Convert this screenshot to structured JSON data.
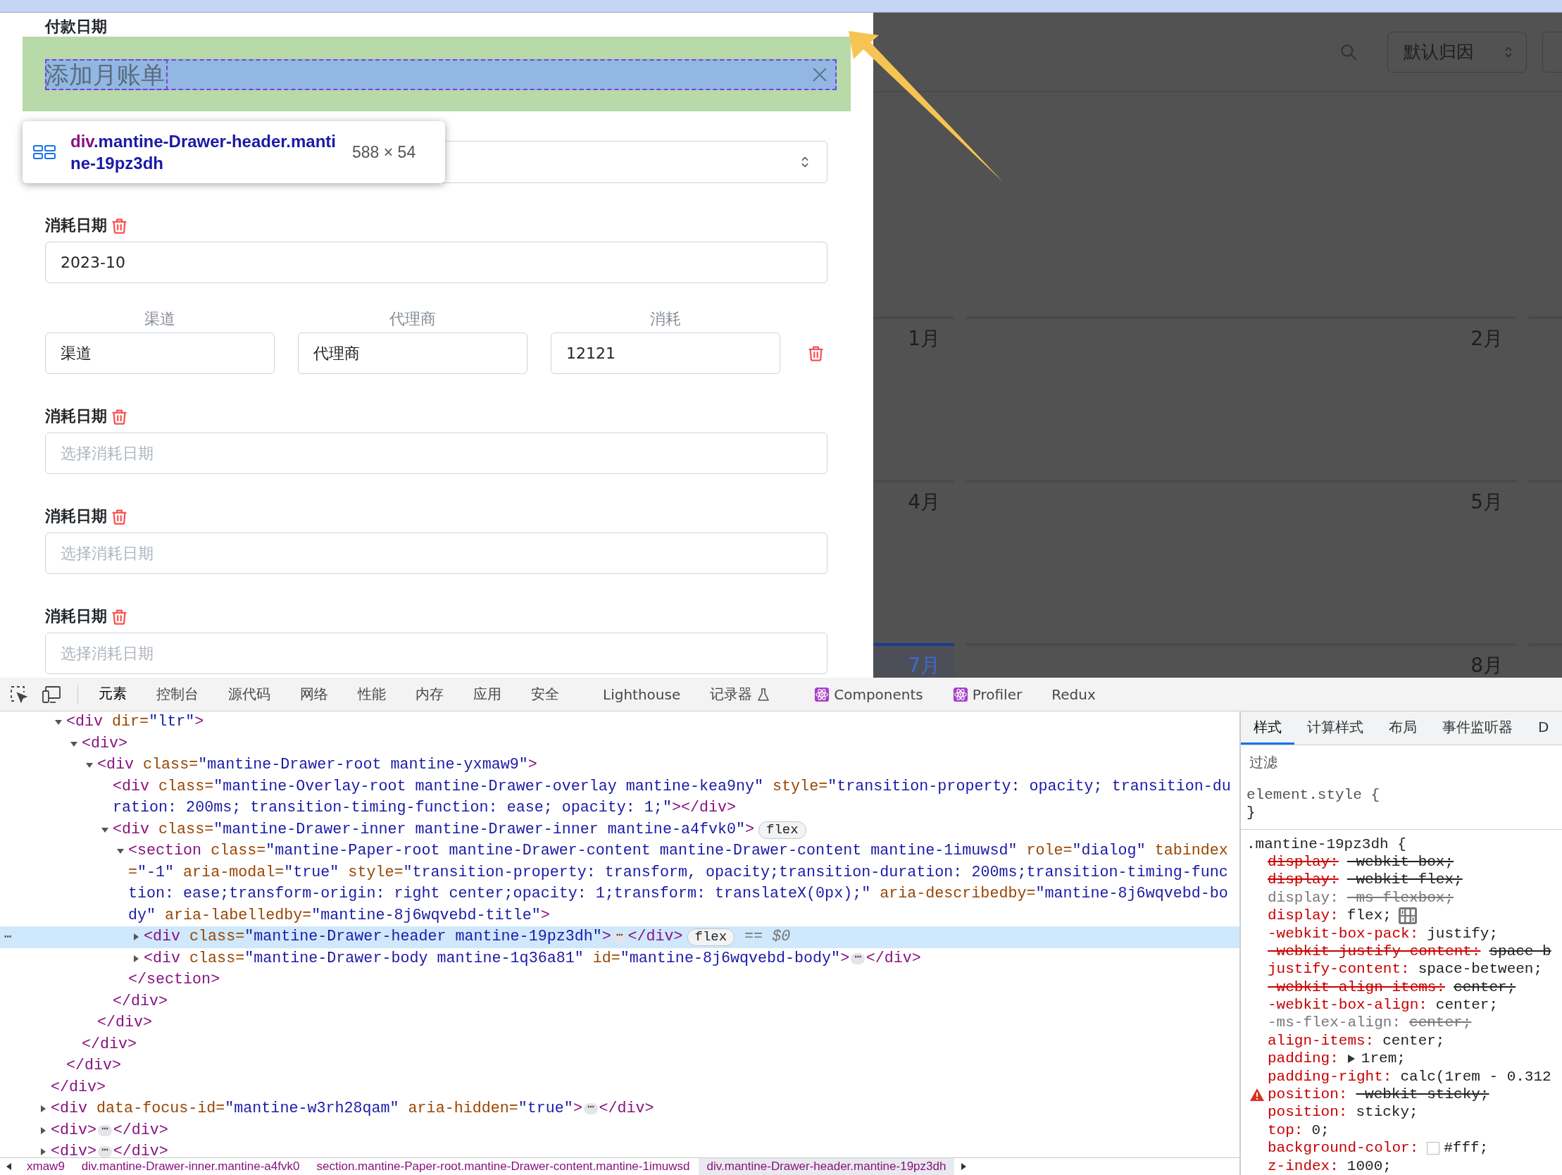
{
  "drawer": {
    "payment_date_label": "付款日期",
    "header": {
      "title": "添加月账单"
    },
    "inspector_tooltip": {
      "tag": "div",
      "classes": ".mantine-Drawer-header.mantine-19pz3dh",
      "size": "588 × 54"
    },
    "blocks": [
      {
        "kind": "date",
        "label": "消耗日期",
        "value": "2023-10"
      },
      {
        "kind": "row",
        "columns": [
          {
            "label": "渠道",
            "value": "渠道"
          },
          {
            "label": "代理商",
            "value": "代理商"
          },
          {
            "label": "消耗",
            "value": "12121"
          }
        ]
      },
      {
        "kind": "date",
        "label": "消耗日期",
        "placeholder": "选择消耗日期"
      },
      {
        "kind": "date",
        "label": "消耗日期",
        "placeholder": "选择消耗日期"
      },
      {
        "kind": "date",
        "label": "消耗日期",
        "placeholder": "选择消耗日期"
      }
    ]
  },
  "background_page": {
    "attribution_select": {
      "value": "默认归因"
    },
    "month_rows": [
      {
        "cells": [
          {
            "label": "1月",
            "selected": false
          },
          {
            "label": "2月",
            "selected": false
          }
        ]
      },
      {
        "cells": [
          {
            "label": "4月",
            "selected": false
          },
          {
            "label": "5月",
            "selected": false
          }
        ]
      },
      {
        "cells": [
          {
            "label": "7月",
            "selected": true
          },
          {
            "label": "8月",
            "selected": false
          }
        ]
      }
    ]
  },
  "devtools": {
    "tabs": [
      {
        "label": "元素",
        "selected": true,
        "kind": "plain"
      },
      {
        "label": "控制台",
        "selected": false,
        "kind": "plain"
      },
      {
        "label": "源代码",
        "selected": false,
        "kind": "plain"
      },
      {
        "label": "网络",
        "selected": false,
        "kind": "plain"
      },
      {
        "label": "性能",
        "selected": false,
        "kind": "plain"
      },
      {
        "label": "内存",
        "selected": false,
        "kind": "plain"
      },
      {
        "label": "应用",
        "selected": false,
        "kind": "plain"
      },
      {
        "label": "安全",
        "selected": false,
        "kind": "plain"
      },
      {
        "label": "Lighthouse",
        "selected": false,
        "kind": "plain"
      },
      {
        "label": "记录器",
        "selected": false,
        "kind": "experimental"
      },
      {
        "label": "Components",
        "selected": false,
        "kind": "react"
      },
      {
        "label": "Profiler",
        "selected": false,
        "kind": "react"
      },
      {
        "label": "Redux",
        "selected": false,
        "kind": "plain"
      }
    ],
    "dom_tree": [
      {
        "children": [
          {
            "open": [
              {
                "kind": "tag",
                "s": "<div"
              },
              {
                "kind": "attr",
                "s": " dir="
              },
              {
                "kind": "val",
                "s": "\"ltr\""
              },
              {
                "kind": "tag",
                "s": ">"
              }
            ],
            "expanded": true,
            "selected": false,
            "children": [
              {
                "open": [
                  {
                    "kind": "tag",
                    "s": "<div>"
                  }
                ],
                "expanded": true,
                "selected": false,
                "children": [
                  {
                    "open": [
                      {
                        "kind": "tag",
                        "s": "<div"
                      },
                      {
                        "kind": "attr",
                        "s": " class="
                      },
                      {
                        "kind": "val",
                        "s": "\"mantine-Drawer-root mantine-yxmaw9\""
                      },
                      {
                        "kind": "tag",
                        "s": ">"
                      }
                    ],
                    "expanded": true,
                    "selected": false,
                    "children": [
                      {
                        "open": [
                          {
                            "kind": "tag",
                            "s": "<div"
                          },
                          {
                            "kind": "attr",
                            "s": " class="
                          },
                          {
                            "kind": "val",
                            "s": "\"mantine-Overlay-root mantine-Drawer-overlay mantine-kea9ny\""
                          },
                          {
                            "kind": "attr",
                            "s": " style="
                          },
                          {
                            "kind": "val",
                            "s": "\"transition-property: opacity; transition-duration: 200ms; transition-timing-function: ease; opacity: 1;\""
                          },
                          {
                            "kind": "tag",
                            "s": "></div>"
                          }
                        ],
                        "selected": false
                      },
                      {
                        "open": [
                          {
                            "kind": "tag",
                            "s": "<div"
                          },
                          {
                            "kind": "attr",
                            "s": " class="
                          },
                          {
                            "kind": "val",
                            "s": "\"mantine-Drawer-inner mantine-Drawer-inner mantine-a4fvk0\""
                          },
                          {
                            "kind": "tag",
                            "s": ">"
                          }
                        ],
                        "badge": "flex",
                        "expanded": true,
                        "selected": false,
                        "children": [
                          {
                            "open": [
                              {
                                "kind": "tag",
                                "s": "<section"
                              },
                              {
                                "kind": "attr",
                                "s": " class="
                              },
                              {
                                "kind": "val",
                                "s": "\"mantine-Paper-root mantine-Drawer-content mantine-Drawer-content mantine-1imuwsd\""
                              },
                              {
                                "kind": "attr",
                                "s": " role="
                              },
                              {
                                "kind": "val",
                                "s": "\"dialog\""
                              },
                              {
                                "kind": "attr",
                                "s": " tabindex="
                              },
                              {
                                "kind": "val",
                                "s": "\"-1\""
                              },
                              {
                                "kind": "attr",
                                "s": " aria-modal="
                              },
                              {
                                "kind": "val",
                                "s": "\"true\""
                              },
                              {
                                "kind": "attr",
                                "s": " style="
                              },
                              {
                                "kind": "val",
                                "s": "\"transition-property: transform, opacity;transition-duration: 200ms;transition-timing-function: ease;transform-origin: right center;opacity: 1;transform: translateX(0px);\""
                              },
                              {
                                "kind": "attr",
                                "s": " aria-describedby="
                              },
                              {
                                "kind": "val",
                                "s": "\"mantine-8j6wqvebd-body\""
                              },
                              {
                                "kind": "attr",
                                "s": " aria-labelledby="
                              },
                              {
                                "kind": "val",
                                "s": "\"mantine-8j6wqvebd-title\""
                              },
                              {
                                "kind": "tag",
                                "s": ">"
                              }
                            ],
                            "expanded": true,
                            "selected": false,
                            "children": [
                              {
                                "open": [
                                  {
                                    "kind": "tag",
                                    "s": "<div"
                                  },
                                  {
                                    "kind": "attr",
                                    "s": " class="
                                  },
                                  {
                                    "kind": "val",
                                    "s": "\"mantine-Drawer-header mantine-19pz3dh\""
                                  },
                                  {
                                    "kind": "tag",
                                    "s": ">"
                                  },
                                  {
                                    "kind": "more",
                                    "s": "⋯"
                                  },
                                  {
                                    "kind": "tag",
                                    "s": "</div>"
                                  }
                                ],
                                "badge": "flex",
                                "ref": "== $0",
                                "gutter": "⋯",
                                "expanded": false,
                                "selected": true
                              },
                              {
                                "open": [
                                  {
                                    "kind": "tag",
                                    "s": "<div"
                                  },
                                  {
                                    "kind": "attr",
                                    "s": " class="
                                  },
                                  {
                                    "kind": "val",
                                    "s": "\"mantine-Drawer-body mantine-1q36a81\""
                                  },
                                  {
                                    "kind": "attr",
                                    "s": " id="
                                  },
                                  {
                                    "kind": "val",
                                    "s": "\"mantine-8j6wqvebd-body\""
                                  },
                                  {
                                    "kind": "tag",
                                    "s": ">"
                                  },
                                  {
                                    "kind": "more",
                                    "s": "⋯"
                                  },
                                  {
                                    "kind": "tag",
                                    "s": "</div>"
                                  }
                                ],
                                "expanded": false,
                                "selected": false
                              }
                            ],
                            "close": [
                              {
                                "kind": "tag",
                                "s": "</section>"
                              }
                            ]
                          }
                        ],
                        "close": [
                          {
                            "kind": "tag",
                            "s": "</div>"
                          }
                        ]
                      }
                    ],
                    "close": [
                      {
                        "kind": "tag",
                        "s": "</div>"
                      }
                    ]
                  }
                ],
                "close": [
                  {
                    "kind": "tag",
                    "s": "</div>"
                  }
                ]
              }
            ],
            "close": [
              {
                "kind": "tag",
                "s": "</div>"
              }
            ]
          }
        ],
        "close": [
          {
            "kind": "tag",
            "s": "</div>"
          }
        ]
      },
      {
        "open": [
          {
            "kind": "tag",
            "s": "<div"
          },
          {
            "kind": "attr",
            "s": " data-focus-id="
          },
          {
            "kind": "val",
            "s": "\"mantine-w3rh28qam\""
          },
          {
            "kind": "attr",
            "s": " aria-hidden="
          },
          {
            "kind": "val",
            "s": "\"true\""
          },
          {
            "kind": "tag",
            "s": ">"
          },
          {
            "kind": "more",
            "s": "⋯"
          },
          {
            "kind": "tag",
            "s": "</div>"
          }
        ],
        "expanded": false,
        "selected": false
      },
      {
        "open": [
          {
            "kind": "tag",
            "s": "<div>"
          },
          {
            "kind": "more",
            "s": "⋯"
          },
          {
            "kind": "tag",
            "s": "</div>"
          }
        ],
        "expanded": false,
        "selected": false
      },
      {
        "open": [
          {
            "kind": "tag",
            "s": "<div>"
          },
          {
            "kind": "more",
            "s": "⋯"
          },
          {
            "kind": "tag",
            "s": "</div>"
          }
        ],
        "expanded": false,
        "selected": false
      }
    ],
    "breadcrumbs": [
      {
        "label": "xmaw9",
        "selected": false
      },
      {
        "label": "div.mantine-Drawer-inner.mantine-a4fvk0",
        "selected": false
      },
      {
        "label": "section.mantine-Paper-root.mantine-Drawer-content.mantine-1imuwsd",
        "selected": false
      },
      {
        "label": "div.mantine-Drawer-header.mantine-19pz3dh",
        "selected": true
      }
    ],
    "styles_panel": {
      "tabs": [
        {
          "label": "样式",
          "selected": true
        },
        {
          "label": "计算样式",
          "selected": false
        },
        {
          "label": "布局",
          "selected": false
        },
        {
          "label": "事件监听器",
          "selected": false
        },
        {
          "label": "D",
          "selected": false
        }
      ],
      "filter_placeholder": "过滤",
      "element_style": {
        "open": "element.style {",
        "close": "}"
      },
      "rule": {
        "selector": ".mantine-19pz3dh {",
        "declarations": [
          {
            "prop": "display:",
            "value": "-webkit-box;",
            "kind": "overridden"
          },
          {
            "prop": "display:",
            "value": "-webkit-flex;",
            "kind": "overridden"
          },
          {
            "prop": "display:",
            "value": "-ms-flexbox;",
            "kind": "unsupported"
          },
          {
            "prop": "display:",
            "value": "flex;",
            "kind": "active",
            "flex_editor": true
          },
          {
            "prop": "-webkit-box-pack:",
            "value": "justify;",
            "kind": "active"
          },
          {
            "prop": "-webkit-justify-content:",
            "value": "space-b",
            "kind": "overridden"
          },
          {
            "prop": "justify-content:",
            "value": "space-between;",
            "kind": "active"
          },
          {
            "prop": "-webkit-align-items:",
            "value": "center;",
            "kind": "overridden"
          },
          {
            "prop": "-webkit-box-align:",
            "value": "center;",
            "kind": "active"
          },
          {
            "prop": "-ms-flex-align:",
            "value": "center;",
            "kind": "unsupported"
          },
          {
            "prop": "align-items:",
            "value": "center;",
            "kind": "active"
          },
          {
            "prop": "padding:",
            "value": "1rem;",
            "kind": "active",
            "expanded": false
          },
          {
            "prop": "padding-right:",
            "value": "calc(1rem - 0.312",
            "kind": "active"
          },
          {
            "prop": "position:",
            "value": "-webkit-sticky;",
            "kind": "invalid"
          },
          {
            "prop": "position:",
            "value": "sticky;",
            "kind": "active"
          },
          {
            "prop": "top:",
            "value": "0;",
            "kind": "active"
          },
          {
            "prop": "background-color:",
            "value": "#fff;",
            "kind": "active",
            "color": "#ffffff"
          },
          {
            "prop": "z-index:",
            "value": "1000;",
            "kind": "active"
          }
        ]
      }
    }
  }
}
